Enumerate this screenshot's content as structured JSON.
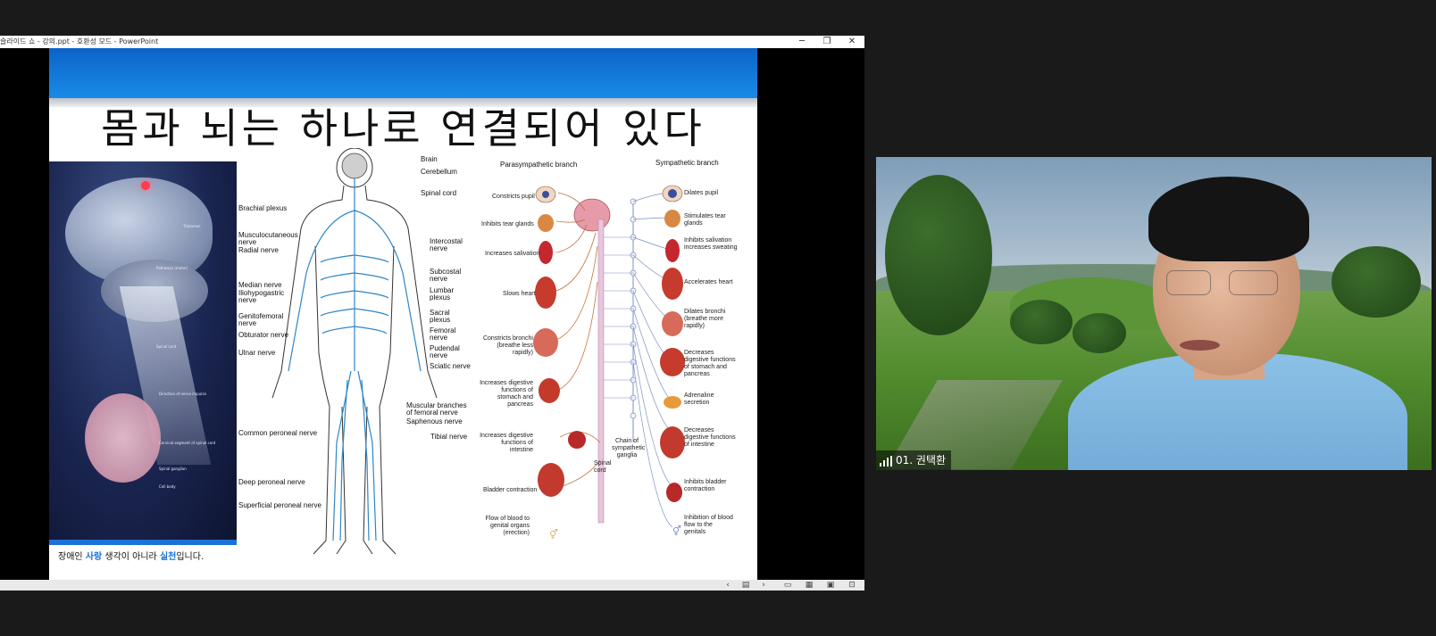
{
  "ppt": {
    "window_title": "슬라이드 쇼 - 강의.ppt - 호환성 모드 - PowerPoint",
    "controls": {
      "minimize": "─",
      "maximize": "❐",
      "close": "✕"
    }
  },
  "slide": {
    "title": "몸과 뇌는 하나로 연결되어 있다",
    "footer_parts": [
      "장애인 ",
      "사랑",
      " 생각이 아니라 ",
      "실천",
      "입니다."
    ],
    "brain_labels": [
      "Thalamus",
      "Pathways (motor)",
      "Spinal cord",
      "Direction of nerve impulse",
      "Cervical segment of spinal cord",
      "Spinal ganglion",
      "Cell body"
    ],
    "nerve_right": [
      "Brain",
      "Cerebellum",
      "Spinal cord",
      "Intercostal nerve",
      "Subcostal nerve",
      "Lumbar plexus",
      "Sacral plexus",
      "Femoral nerve",
      "Pudendal nerve",
      "Sciatic nerve",
      "Muscular branches of femoral nerve",
      "Saphenous nerve",
      "Tibial nerve"
    ],
    "nerve_left": [
      "Brachial plexus",
      "Musculocutaneous nerve",
      "Radial nerve",
      "Median nerve",
      "Iliohypogastric nerve",
      "Genitofemoral nerve",
      "Obturator nerve",
      "Ulnar nerve",
      "Common peroneal nerve",
      "Deep peroneal nerve",
      "Superficial peroneal nerve"
    ],
    "parasym_head": "Parasympathetic branch",
    "sym_head": "Sympathetic branch",
    "parasym": [
      "Constricts pupil",
      "Inhibits tear glands",
      "Increases salivation",
      "Slows heart",
      "Constricts bronchi (breathe less rapidly)",
      "Increases digestive functions of stomach and pancreas",
      "Increases digestive functions of intestine",
      "Bladder contraction",
      "Flow of blood to genital organs (erection)"
    ],
    "sym": [
      "Dilates pupil",
      "Stimulates tear glands",
      "Inhibits salivation increases sweating",
      "Accelerates heart",
      "Dilates bronchi (breathe more rapidly)",
      "Decreases digestive functions of stomach and pancreas",
      "Adrenaline secretion",
      "Decreases digestive functions of intestine",
      "Inhibits bladder contraction",
      "Inhibition of blood flow to the genitals"
    ],
    "center_labels": [
      "Chain of sympathetic ganglia",
      "Spinal cord"
    ]
  },
  "statusbar": {
    "prev": "‹",
    "slides": "▤",
    "next": "›",
    "normal": "▭",
    "sorter": "▦",
    "reading": "▣",
    "show": "⊡"
  },
  "video": {
    "participant_name": "01. 권택환"
  }
}
